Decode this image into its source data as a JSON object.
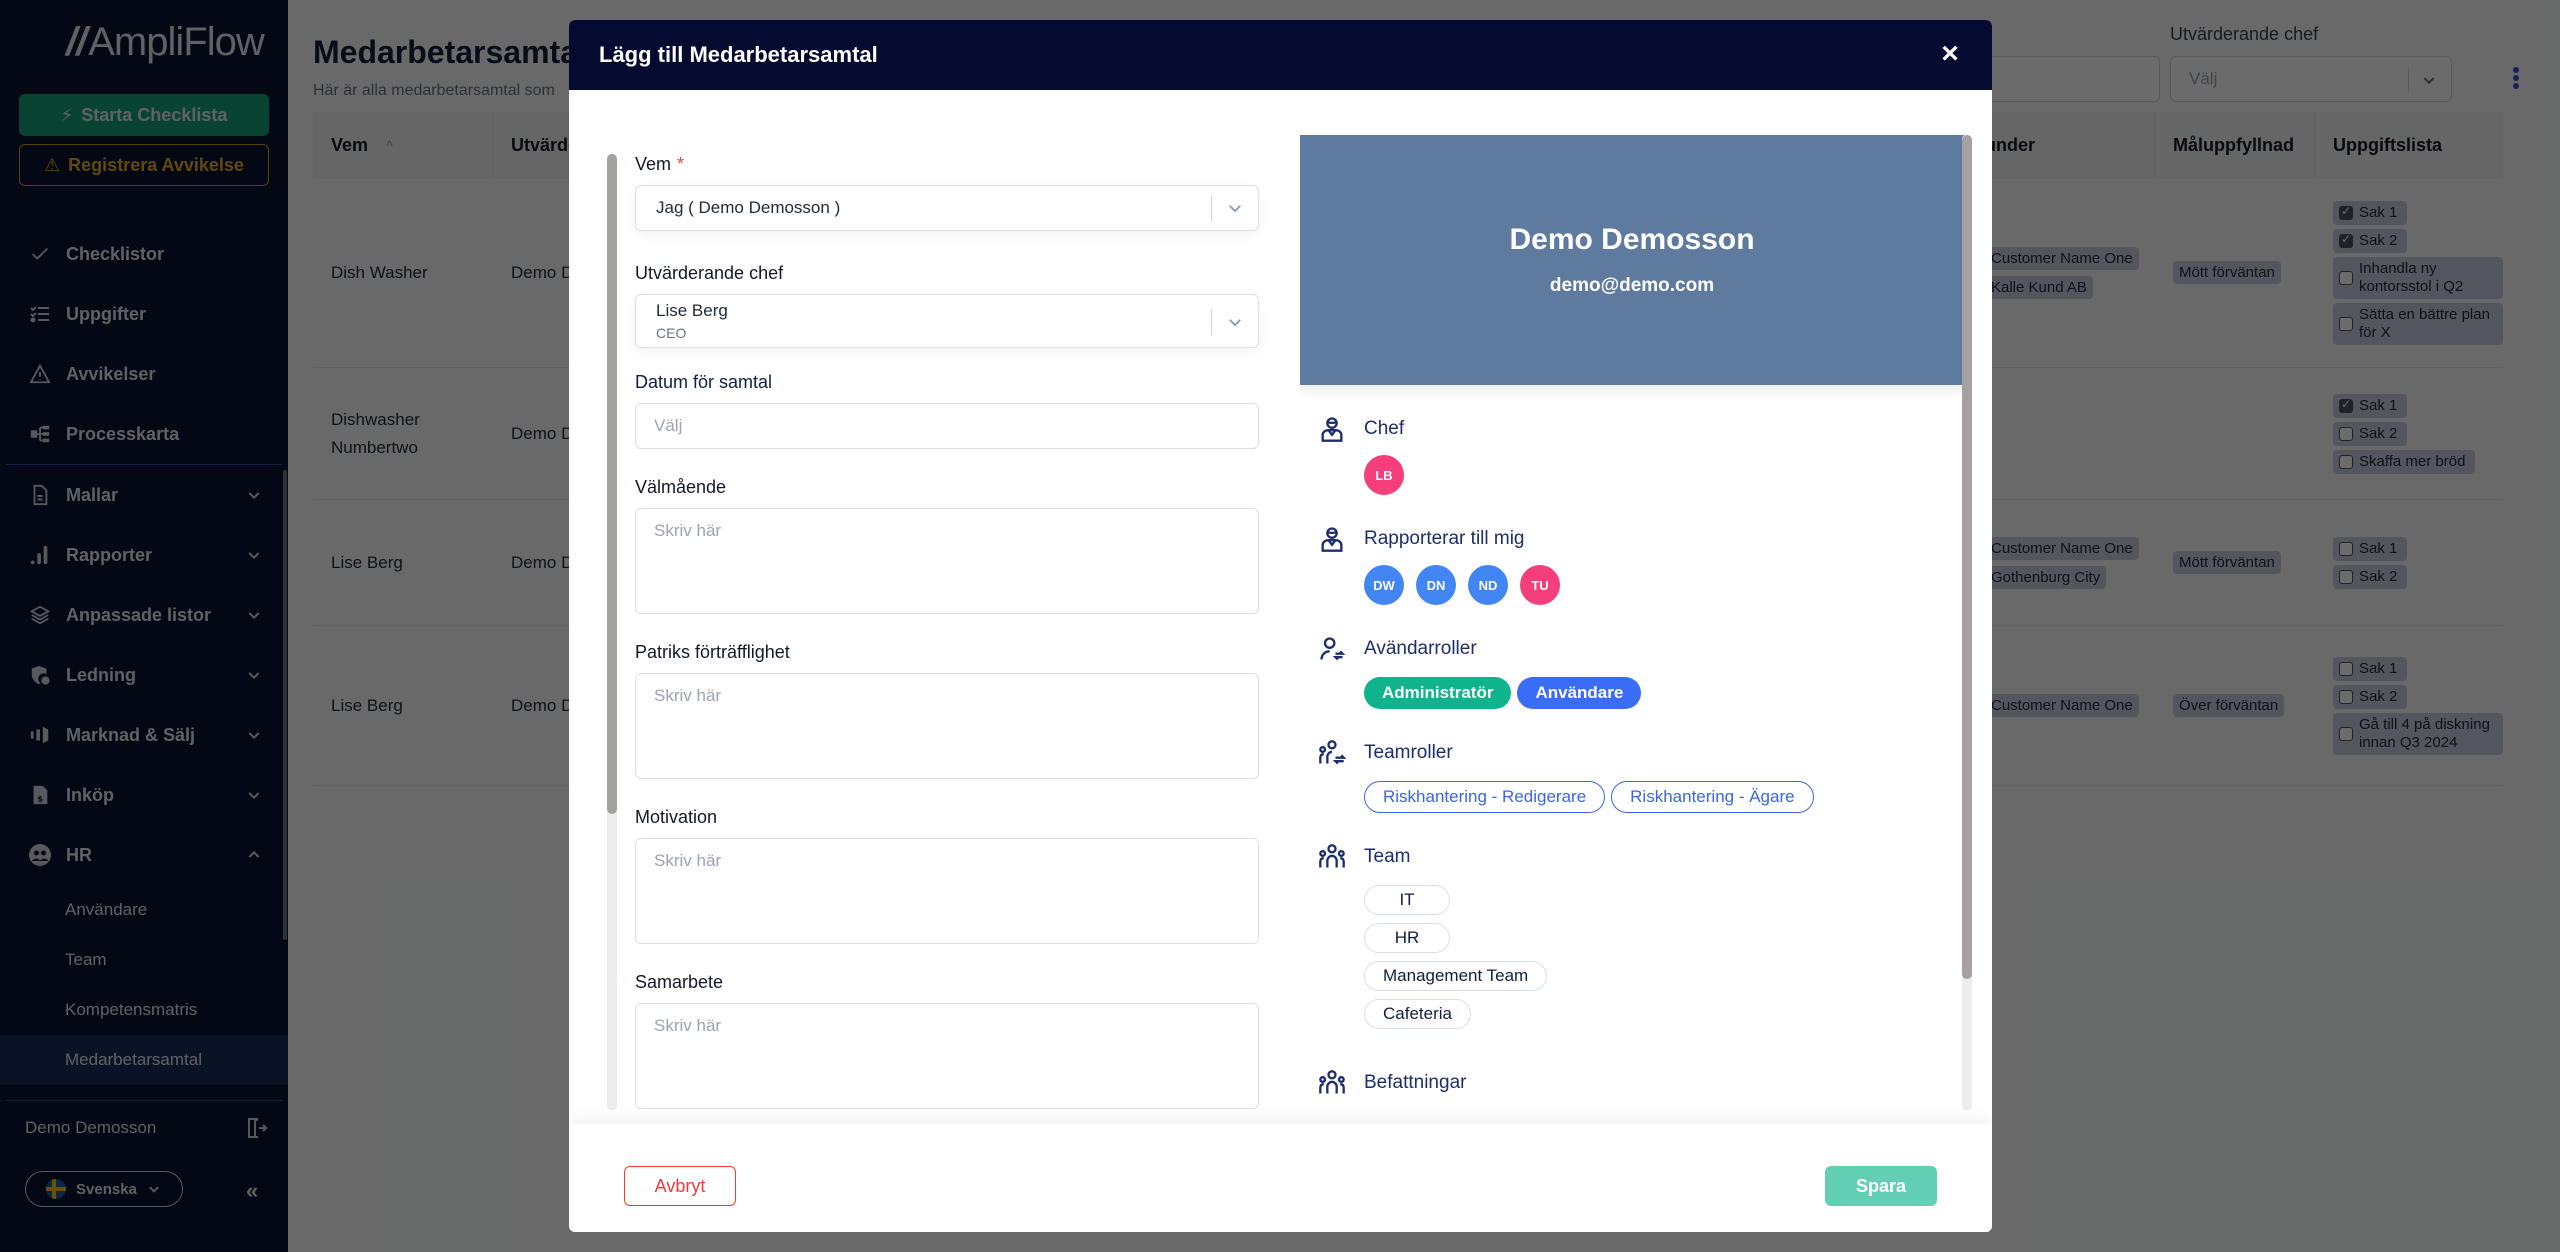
{
  "app": {
    "logo_text": "AmpliFlow"
  },
  "sidebar": {
    "start_checklist": "Starta Checklista",
    "register_deviation": "Registrera Avvikelse",
    "items": [
      {
        "label": "Checklistor",
        "icon": "check-icon",
        "expandable": false
      },
      {
        "label": "Uppgifter",
        "icon": "task-list-icon",
        "expandable": false
      },
      {
        "label": "Avvikelser",
        "icon": "warning-icon",
        "expandable": false
      },
      {
        "label": "Processkarta",
        "icon": "process-map-icon",
        "expandable": false
      },
      {
        "label": "Mallar",
        "icon": "document-icon",
        "expandable": true
      },
      {
        "label": "Rapporter",
        "icon": "bar-chart-icon",
        "expandable": true
      },
      {
        "label": "Anpassade listor",
        "icon": "layers-icon",
        "expandable": true
      },
      {
        "label": "Ledning",
        "icon": "shield-user-icon",
        "expandable": true
      },
      {
        "label": "Marknad & Sälj",
        "icon": "megaphone-icon",
        "expandable": true
      },
      {
        "label": "Inköp",
        "icon": "invoice-icon",
        "expandable": true
      },
      {
        "label": "HR",
        "icon": "people-icon",
        "expandable": true,
        "expanded": true
      }
    ],
    "hr_subitems": [
      {
        "label": "Användare",
        "active": false
      },
      {
        "label": "Team",
        "active": false
      },
      {
        "label": "Kompetensmatris",
        "active": false
      },
      {
        "label": "Medarbetarsamtal",
        "active": true
      }
    ],
    "user_name": "Demo Demosson",
    "language": "Svenska"
  },
  "page": {
    "title": "Medarbetarsamtal",
    "subtitle": "Här är alla medarbetarsamtal som",
    "filter_label": "Utvärderande chef",
    "filter_placeholder": "Välj",
    "columns": [
      "Vem",
      "Utvärde",
      "under",
      "Måluppfyllnad",
      "Uppgiftslista"
    ],
    "rows": [
      {
        "vem": "Dish Washer",
        "chef": "Demo D",
        "customers": [
          "Customer Name One",
          "Kalle Kund AB"
        ],
        "goal": "Mött förväntan",
        "tasks": [
          {
            "label": "Sak 1",
            "checked": true
          },
          {
            "label": "Sak 2",
            "checked": true
          },
          {
            "label": "Inhandla ny kontorsstol i Q2",
            "checked": false
          },
          {
            "label": "Sätta en bättre plan för X",
            "checked": false
          }
        ]
      },
      {
        "vem": "Dishwasher Numbertwo",
        "chef": "Demo D",
        "customers": [],
        "goal": "",
        "tasks": [
          {
            "label": "Sak 1",
            "checked": true
          },
          {
            "label": "Sak 2",
            "checked": false
          },
          {
            "label": "Skaffa mer bröd",
            "checked": false
          }
        ]
      },
      {
        "vem": "Lise Berg",
        "chef": "Demo D",
        "customers": [
          "Customer Name One",
          "Gothenburg City"
        ],
        "goal": "Mött förväntan",
        "tasks": [
          {
            "label": "Sak 1",
            "checked": false
          },
          {
            "label": "Sak 2",
            "checked": false
          }
        ]
      },
      {
        "vem": "Lise Berg",
        "chef": "Demo D",
        "customers": [
          "Customer Name One"
        ],
        "goal": "Över förväntan",
        "tasks": [
          {
            "label": "Sak 1",
            "checked": false
          },
          {
            "label": "Sak 2",
            "checked": false
          },
          {
            "label": "Gå till 4 på diskning innan Q3 2024",
            "checked": false
          }
        ]
      }
    ]
  },
  "modal": {
    "title": "Lägg till Medarbetarsamtal",
    "close_label": "×",
    "form": {
      "vem_label": "Vem",
      "vem_required": "*",
      "vem_value": "Jag ( Demo Demosson )",
      "chef_label": "Utvärderande chef",
      "chef_value": "Lise Berg",
      "chef_sub": "CEO",
      "date_label": "Datum för samtal",
      "date_placeholder": "Välj",
      "textareas": [
        {
          "label": "Välmående",
          "placeholder": "Skriv här"
        },
        {
          "label": "Patriks förträfflighet",
          "placeholder": "Skriv här"
        },
        {
          "label": "Motivation",
          "placeholder": "Skriv här"
        },
        {
          "label": "Samarbete",
          "placeholder": "Skriv här"
        }
      ]
    },
    "profile": {
      "name": "Demo Demosson",
      "email": "demo@demo.com",
      "chef_title": "Chef",
      "chef_avatars": [
        {
          "initials": "LB",
          "color": "#f43f7a"
        }
      ],
      "reports_title": "Rapporterar till mig",
      "reports_avatars": [
        {
          "initials": "DW",
          "color": "#4286f4"
        },
        {
          "initials": "DN",
          "color": "#4286f4"
        },
        {
          "initials": "ND",
          "color": "#4286f4"
        },
        {
          "initials": "TU",
          "color": "#f43f7a"
        }
      ],
      "user_roles_title": "Avändarroller",
      "user_roles": [
        {
          "label": "Administratör",
          "color": "#10b48c"
        },
        {
          "label": "Användare",
          "color": "#3b6cf6"
        }
      ],
      "team_roles_title": "Teamroller",
      "team_roles": [
        "Riskhantering - Redigerare",
        "Riskhantering - Ägare"
      ],
      "teams_title": "Team",
      "teams": [
        "IT",
        "HR",
        "Management Team",
        "Cafeteria"
      ],
      "positions_title": "Befattningar"
    },
    "cancel_label": "Avbryt",
    "save_label": "Spara"
  }
}
